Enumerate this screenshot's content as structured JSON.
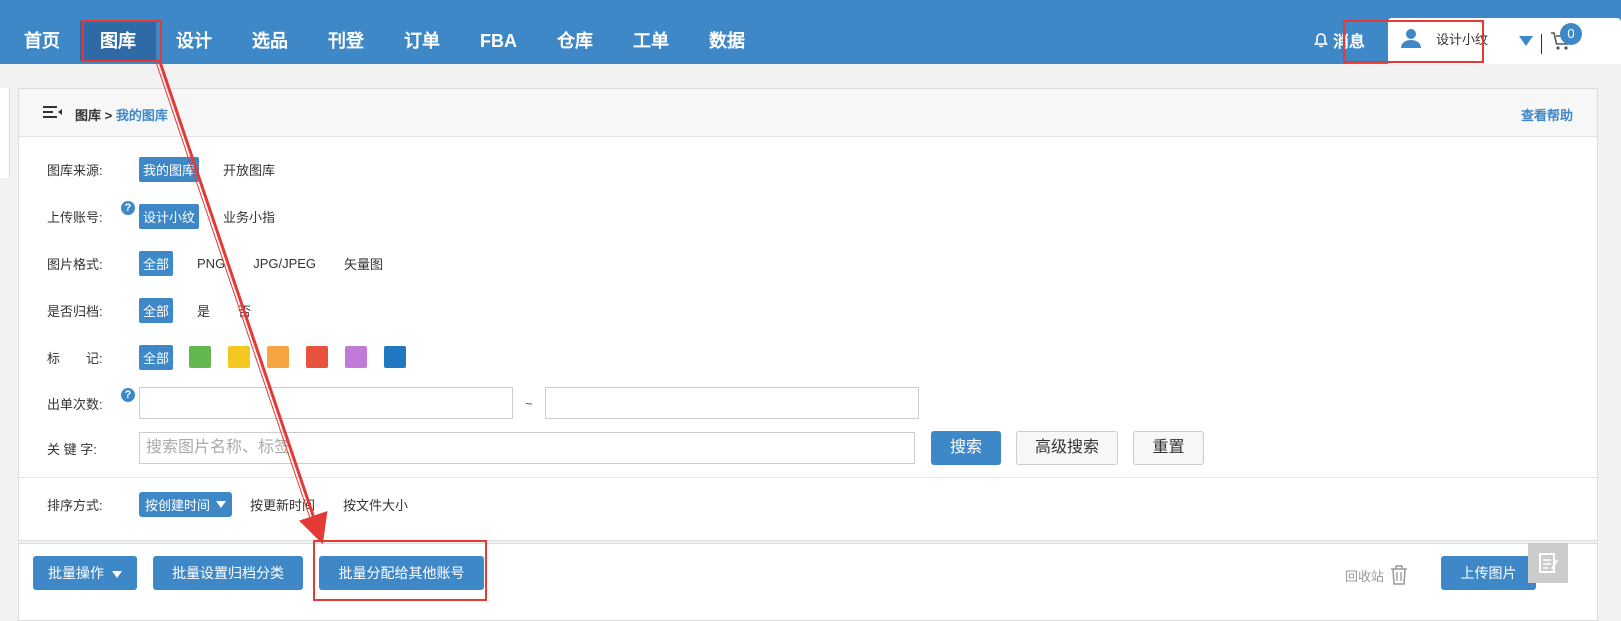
{
  "nav": {
    "items": [
      "首页",
      "图库",
      "设计",
      "选品",
      "刊登",
      "订单",
      "FBA",
      "仓库",
      "工单",
      "数据"
    ],
    "active_index": 1
  },
  "header": {
    "messages_label": "消息",
    "user_name": "设计小纹",
    "cart_count": "0"
  },
  "breadcrumb": {
    "root": "图库",
    "separator": " > ",
    "current": "我的图库"
  },
  "help_link": "查看帮助",
  "filters": {
    "source": {
      "label": "图库来源:",
      "options": [
        "我的图库",
        "开放图库"
      ],
      "selected": 0
    },
    "account": {
      "label": "上传账号:",
      "options": [
        "设计小纹",
        "业务小指"
      ],
      "selected": 0
    },
    "format": {
      "label": "图片格式:",
      "options": [
        "全部",
        "PNG",
        "JPG/JPEG",
        "矢量图"
      ],
      "selected": 0
    },
    "archived": {
      "label": "是否归档:",
      "options": [
        "全部",
        "是",
        "否"
      ],
      "selected": 0
    },
    "mark": {
      "label": "标　　记:",
      "all_label": "全部",
      "colors": [
        "#62b84f",
        "#f2c821",
        "#f6a540",
        "#e9533e",
        "#c27ad9",
        "#2278c0"
      ]
    },
    "orders": {
      "label": "出单次数:",
      "range_sep": "~"
    },
    "keyword": {
      "label": "关  键  字:",
      "placeholder": "搜索图片名称、标签"
    }
  },
  "buttons": {
    "search": "搜索",
    "advanced_search": "高级搜索",
    "reset": "重置"
  },
  "sort": {
    "label": "排序方式:",
    "selected": "按创建时间",
    "options": [
      "按更新时间",
      "按文件大小"
    ]
  },
  "toolbar": {
    "batch_ops": "批量操作",
    "batch_archive": "批量设置归档分类",
    "batch_assign": "批量分配给其他账号",
    "recycle": "回收站",
    "upload": "上传图片"
  },
  "colors": {
    "brand": "#3f88c8",
    "highlight": "#e53935"
  }
}
